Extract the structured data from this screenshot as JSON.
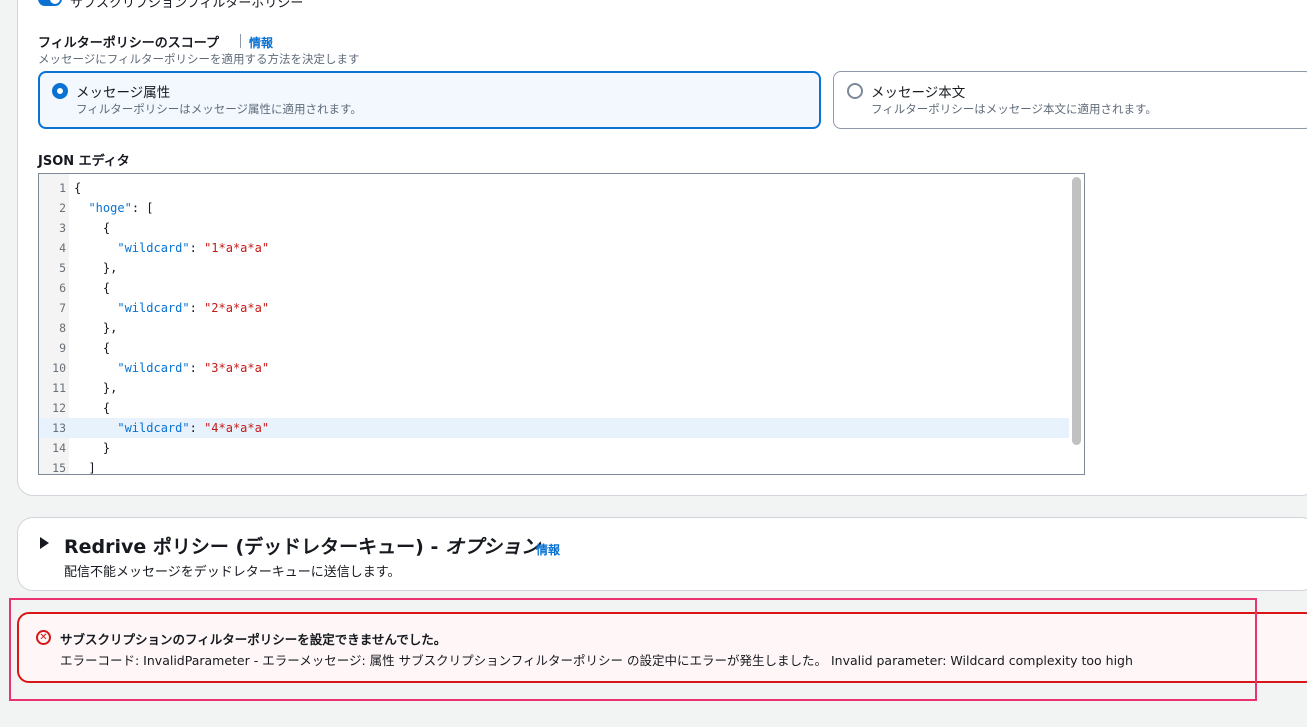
{
  "subscription": {
    "toggle_label": "サブスクリプションフィルターポリシー"
  },
  "scope": {
    "title": "フィルターポリシーのスコープ",
    "info_link": "情報",
    "description": "メッセージにフィルターポリシーを適用する方法を決定します",
    "options": [
      {
        "label": "メッセージ属性",
        "description": "フィルターポリシーはメッセージ属性に適用されます。",
        "selected": true
      },
      {
        "label": "メッセージ本文",
        "description": "フィルターポリシーはメッセージ本文に適用されます。",
        "selected": false
      }
    ]
  },
  "editor": {
    "label": "JSON エディタ",
    "active_line": 13,
    "lines": [
      {
        "n": "1",
        "indent": "",
        "key": "",
        "str": "",
        "rest": "{"
      },
      {
        "n": "2",
        "indent": "  ",
        "key": "\"hoge\"",
        "str": "",
        "rest": ": ["
      },
      {
        "n": "3",
        "indent": "    ",
        "key": "",
        "str": "",
        "rest": "{"
      },
      {
        "n": "4",
        "indent": "      ",
        "key": "\"wildcard\"",
        "str": "\"1*a*a*a\"",
        "rest": ""
      },
      {
        "n": "5",
        "indent": "    ",
        "key": "",
        "str": "",
        "rest": "},"
      },
      {
        "n": "6",
        "indent": "    ",
        "key": "",
        "str": "",
        "rest": "{"
      },
      {
        "n": "7",
        "indent": "      ",
        "key": "\"wildcard\"",
        "str": "\"2*a*a*a\"",
        "rest": ""
      },
      {
        "n": "8",
        "indent": "    ",
        "key": "",
        "str": "",
        "rest": "},"
      },
      {
        "n": "9",
        "indent": "    ",
        "key": "",
        "str": "",
        "rest": "{"
      },
      {
        "n": "10",
        "indent": "      ",
        "key": "\"wildcard\"",
        "str": "\"3*a*a*a\"",
        "rest": ""
      },
      {
        "n": "11",
        "indent": "    ",
        "key": "",
        "str": "",
        "rest": "},"
      },
      {
        "n": "12",
        "indent": "    ",
        "key": "",
        "str": "",
        "rest": "{"
      },
      {
        "n": "13",
        "indent": "      ",
        "key": "\"wildcard\"",
        "str": "\"4*a*a*a\"",
        "rest": ""
      },
      {
        "n": "14",
        "indent": "    ",
        "key": "",
        "str": "",
        "rest": "}"
      },
      {
        "n": "15",
        "indent": "  ",
        "key": "",
        "str": "",
        "rest": "]"
      }
    ]
  },
  "redrive": {
    "title": "Redrive ポリシー (デッドレターキュー) - ",
    "title_optional": "オプション",
    "info_link": "情報",
    "description": "配信不能メッセージをデッドレターキューに送信します。"
  },
  "alert": {
    "icon": "error-circle-icon",
    "title": "サブスクリプションのフィルターポリシーを設定できませんでした。",
    "message": "エラーコード: InvalidParameter - エラーメッセージ: 属性 サブスクリプションフィルターポリシー の設定中にエラーが発生しました。 Invalid parameter: Wildcard complexity too high"
  },
  "colors": {
    "accent": "#0972d3",
    "error": "#d91515",
    "highlight": "#e8336e"
  }
}
